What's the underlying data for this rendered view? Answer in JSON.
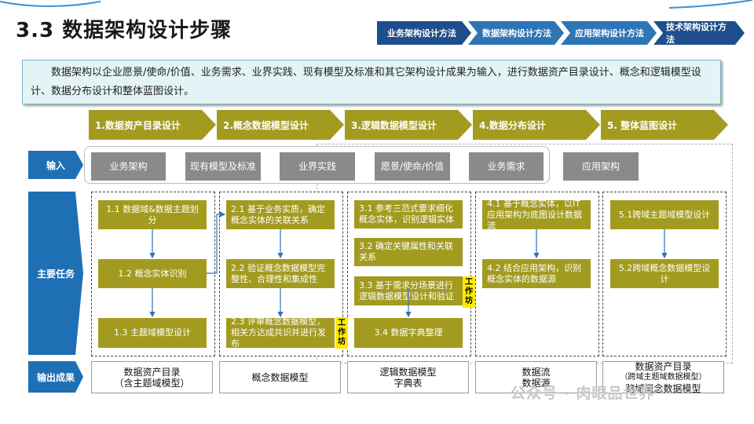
{
  "title": "3.3 数据架构设计步骤",
  "nav": [
    {
      "label": "业务架构设计方法",
      "style": "dark"
    },
    {
      "label": "数据架构设计方法",
      "style": "light"
    },
    {
      "label": "应用架构设计方法",
      "style": "light"
    },
    {
      "label": "技术架构设计方法",
      "style": "dark"
    }
  ],
  "intro": "数据架构以企业愿景/使命/价值、业务需求、业界实践、现有模型及标准和其它架构设计成果为输入，进行数据资产目录设计、概念和逻辑模型设计、数据分布设计和整体蓝图设计。",
  "steps": [
    "1.数据资产目录设计",
    "2.概念数据模型设计",
    "3.逻辑数据模型设计",
    "4.数据分布设计",
    "5. 整体蓝图设计"
  ],
  "row_labels": {
    "input": "输入",
    "tasks": "主要任务",
    "output": "输出成果"
  },
  "inputs": [
    "业务架构",
    "现有模型及标准",
    "业界实践",
    "愿景/使命/价值",
    "业务需求",
    "应用架构"
  ],
  "tasks": {
    "c1": [
      "1.1 数据域&数据主题划分",
      "1.2 概念实体识别",
      "1.3 主题域模型设计"
    ],
    "c2": [
      "2.1 基于业务实质，确定概念实体的关联关系",
      "2.2 验证概念数据模型完整性、合理性和集成性",
      "2.3 评审概念数据模型，相关方达成共识并进行发布"
    ],
    "c3": [
      "3.1 参考三范式要求细化概念实体，识别逻辑实体",
      "3.2 确定关键属性和关联关系",
      "3.3 基于需求分场景进行逻辑数据模型设计和验证",
      "3.4 数据字典整理"
    ],
    "c4": [
      "4.1 基于概念实体，以IT应用架构为底图设计数据流",
      "4.2 结合应用架构，识别概念实体的数据源"
    ],
    "c5": [
      "5.1跨域主题域模型设计",
      "5.2跨域概念数据模型设计"
    ]
  },
  "badge": "工作坊",
  "outputs": [
    {
      "line1": "数据资产目录",
      "line2": "（含主题域模型）"
    },
    {
      "line1": "概念数据模型",
      "line2": ""
    },
    {
      "line1": "逻辑数据模型",
      "line2": "字典表"
    },
    {
      "line1": "数据流",
      "line2": "数据源"
    },
    {
      "line1": "数据资产目录",
      "line2": "（跨域主题域数据模型）",
      "line3": "跨域概念数据模型"
    }
  ],
  "watermark": "公众号 · 肉眼品世界",
  "colors": {
    "olive": "#a29b1f",
    "blue": "#1f6fb5",
    "navy": "#1f4e8c",
    "gray": "#8a8a8a",
    "badge": "#ffea00"
  }
}
